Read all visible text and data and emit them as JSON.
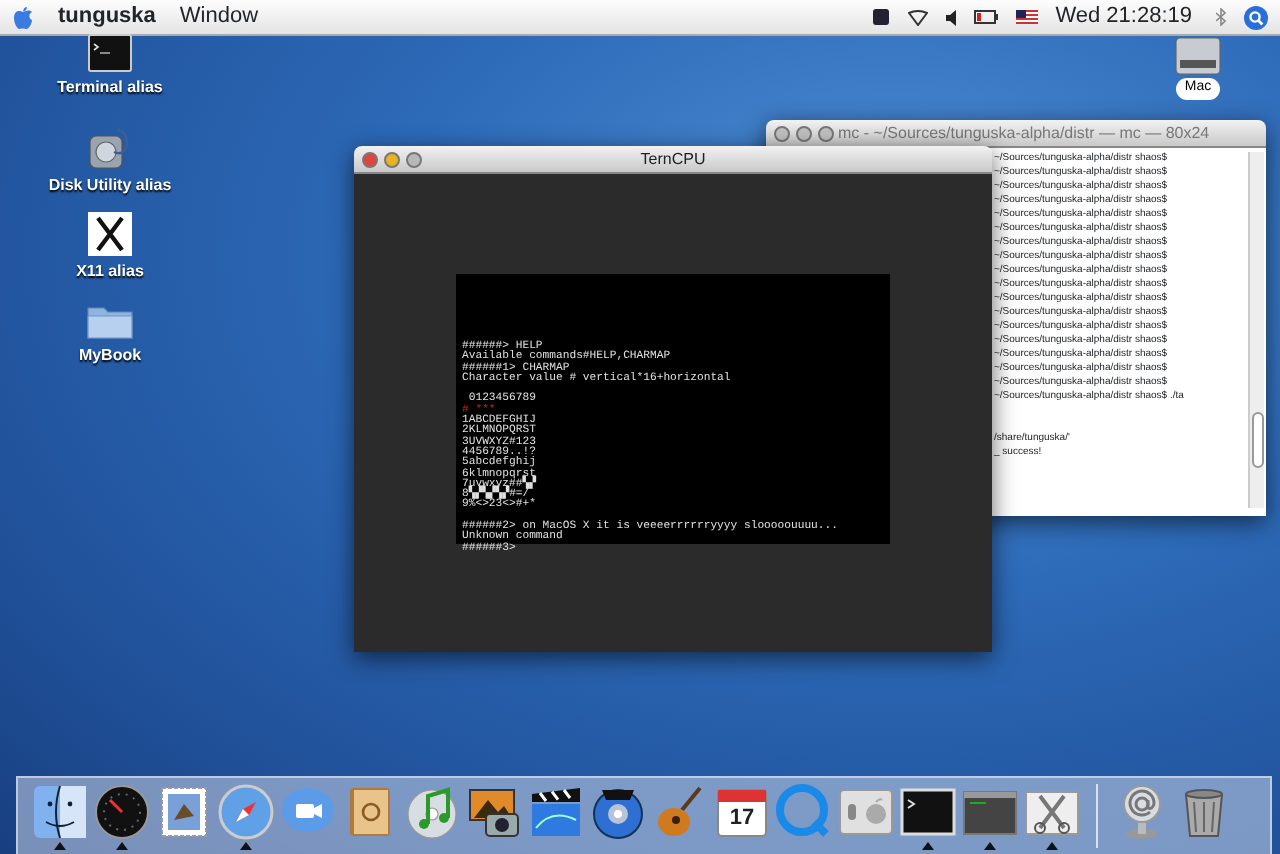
{
  "menu_bar": {
    "app_name": "tunguska",
    "menus": [
      "Window"
    ],
    "clock": "Wed 21:28:19"
  },
  "desktop_icons": [
    {
      "kind": "terminal",
      "label": "Terminal alias"
    },
    {
      "kind": "disk-utility",
      "label": "Disk Utility alias"
    },
    {
      "kind": "x-letter",
      "label": "X11 alias"
    },
    {
      "kind": "folder",
      "label": "MyBook"
    }
  ],
  "drive": {
    "label": "Mac"
  },
  "terminal_window": {
    "title": "mc - ~/Sources/tunguska-alpha/distr — mc — 80x24",
    "active": false,
    "blocks": [
      [
        "~/Sources/tunguska-alpha/distr shaos$",
        "~/Sources/tunguska-alpha/distr shaos$",
        "~/Sources/tunguska-alpha/distr shaos$",
        "~/Sources/tunguska-alpha/distr shaos$",
        "~/Sources/tunguska-alpha/distr shaos$",
        "~/Sources/tunguska-alpha/distr shaos$",
        "~/Sources/tunguska-alpha/distr shaos$",
        "~/Sources/tunguska-alpha/distr shaos$",
        "~/Sources/tunguska-alpha/distr shaos$",
        "~/Sources/tunguska-alpha/distr shaos$",
        "~/Sources/tunguska-alpha/distr shaos$",
        "~/Sources/tunguska-alpha/distr shaos$",
        "~/Sources/tunguska-alpha/distr shaos$",
        "~/Sources/tunguska-alpha/distr shaos$",
        "~/Sources/tunguska-alpha/distr shaos$",
        "~/Sources/tunguska-alpha/distr shaos$",
        "~/Sources/tunguska-alpha/distr shaos$",
        "~/Sources/tunguska-alpha/distr shaos$ ./ta"
      ],
      [
        "/share/tunguska/'",
        "_ success!"
      ]
    ]
  },
  "emulator_window": {
    "title": "TernCPU",
    "active": true,
    "blocks": [
      [
        {
          "text": "######> HELP",
          "kind": "plain"
        },
        {
          "text": "Available commands#HELP,CHARMAP",
          "kind": "plain"
        },
        {
          "text": "######1> CHARMAP",
          "kind": "plain"
        },
        {
          "text": "Character value # vertical*16+horizontal",
          "kind": "plain"
        }
      ],
      [
        {
          "text": " 0123456789",
          "kind": "plain"
        },
        {
          "text": "# ***",
          "kind": "accent"
        },
        {
          "text": "1ABCDEFGHIJ",
          "kind": "plain"
        },
        {
          "text": "2KLMNOPQRST",
          "kind": "plain"
        },
        {
          "text": "3UVWXYZ#123",
          "kind": "plain"
        },
        {
          "text": "4456789..!?",
          "kind": "plain"
        },
        {
          "text": "5abcdefghij",
          "kind": "plain"
        },
        {
          "text": "6klmnopqrst",
          "kind": "plain"
        },
        {
          "text": "7uvwxyz##▚▞",
          "kind": "plain"
        },
        {
          "text": "8▚▞▚▞▚▞#=/",
          "kind": "plain"
        },
        {
          "text": "9%<>23<>#+*",
          "kind": "plain"
        }
      ],
      [
        {
          "text": "######2> on MacOS X it is veeeerrrrrryyyy slooooouuuu...",
          "kind": "plain"
        },
        {
          "text": "Unknown command",
          "kind": "plain"
        },
        {
          "text": "######3>",
          "kind": "plain"
        }
      ]
    ]
  },
  "dock": {
    "items": [
      {
        "kind": "face",
        "running": true
      },
      {
        "kind": "gauge",
        "running": true
      },
      {
        "kind": "stamp",
        "running": false
      },
      {
        "kind": "compass",
        "running": true
      },
      {
        "kind": "camera-bubble",
        "running": false
      },
      {
        "kind": "book",
        "running": false
      },
      {
        "kind": "cd-note",
        "running": false
      },
      {
        "kind": "photo",
        "running": false
      },
      {
        "kind": "clapper",
        "running": false
      },
      {
        "kind": "disc",
        "running": false
      },
      {
        "kind": "guitar",
        "running": false
      },
      {
        "kind": "calendar",
        "running": false,
        "day": "17"
      },
      {
        "kind": "q-circle",
        "running": false
      },
      {
        "kind": "switch",
        "running": false
      },
      {
        "kind": "terminal",
        "running": true
      },
      {
        "kind": "window",
        "running": true
      },
      {
        "kind": "scissors",
        "running": true
      }
    ],
    "others": [
      {
        "kind": "at-sign"
      },
      {
        "kind": "trash"
      }
    ]
  }
}
